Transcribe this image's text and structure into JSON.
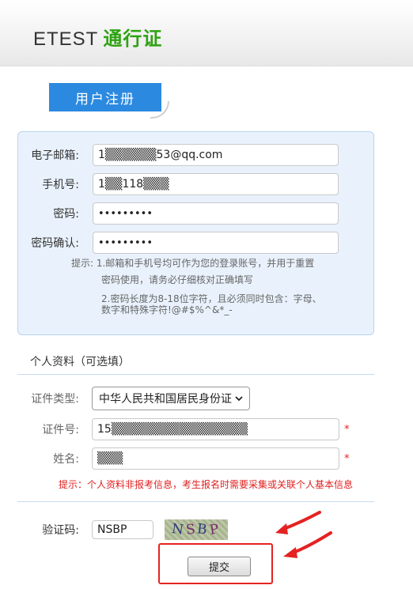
{
  "header": {
    "brand_prefix": "ETEST",
    "brand_suffix": "通行证"
  },
  "register_tab": {
    "label": "用户注册"
  },
  "account": {
    "email_label": "电子邮箱:",
    "email_value": "1▒▒▒▒▒▒53@qq.com",
    "phone_label": "手机号:",
    "phone_value": "1▒▒118▒▒▒",
    "password_label": "密码:",
    "password_value": "•••••••••",
    "confirm_label": "密码确认:",
    "confirm_value": "•••••••••",
    "hint_1a": "提示: 1.邮箱和手机号均可作为您的登录账号，并用于重置",
    "hint_1b": "密码使用，请务必仔细核对正确填写",
    "hint_2a": "2.密码长度为8-18位字符，且必须同时包含：字母、",
    "hint_2b": "数字和特殊字符!@#$%^&*_-"
  },
  "personal": {
    "section_title": "个人资料（可选填）",
    "id_type_label": "证件类型:",
    "id_type_value": "中华人民共和国居民身份证",
    "id_number_label": "证件号:",
    "id_number_value": "15▒▒▒▒▒▒▒▒▒▒▒▒▒▒▒▒",
    "name_label": "姓名:",
    "name_value": "▒▒▒",
    "required_mark": "*",
    "notice": "提示：个人资料非报考信息，考生报名时需要采集或关联个人基本信息"
  },
  "captcha": {
    "label": "验证码:",
    "value": "NSBP",
    "image_chars": [
      "N",
      "S",
      "B",
      "P"
    ]
  },
  "submit": {
    "label": "提交"
  },
  "colors": {
    "accent_blue": "#2b89e0",
    "brand_green": "#2ea312",
    "alert_red": "#e02020"
  }
}
